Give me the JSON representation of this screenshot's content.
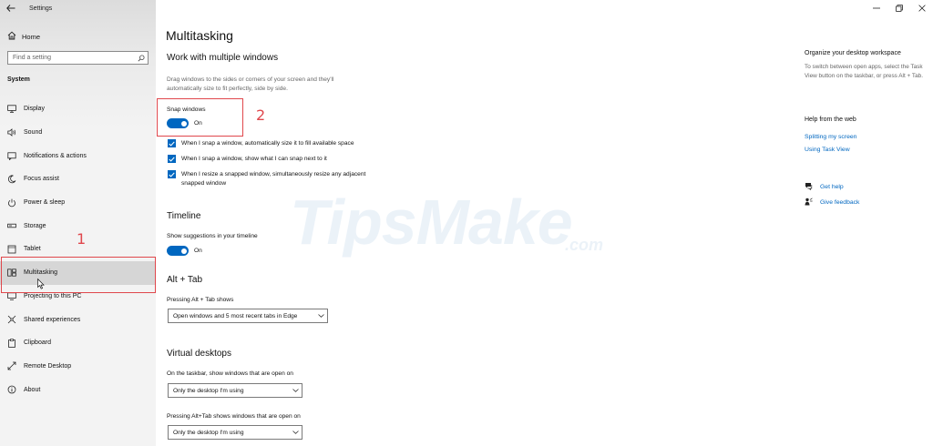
{
  "window": {
    "title": "Settings",
    "back_icon": "back-arrow-icon",
    "minimize_icon": "minimize-icon",
    "restore_icon": "restore-icon",
    "close_icon": "close-icon"
  },
  "sidebar": {
    "home_label": "Home",
    "search_placeholder": "Find a setting",
    "section_title": "System",
    "items": [
      {
        "label": "Display",
        "icon": "display-icon"
      },
      {
        "label": "Sound",
        "icon": "sound-icon"
      },
      {
        "label": "Notifications & actions",
        "icon": "notifications-icon"
      },
      {
        "label": "Focus assist",
        "icon": "focus-assist-icon"
      },
      {
        "label": "Power & sleep",
        "icon": "power-icon"
      },
      {
        "label": "Storage",
        "icon": "storage-icon"
      },
      {
        "label": "Tablet",
        "icon": "tablet-icon"
      },
      {
        "label": "Multitasking",
        "icon": "multitasking-icon",
        "selected": true
      },
      {
        "label": "Projecting to this PC",
        "icon": "projecting-icon"
      },
      {
        "label": "Shared experiences",
        "icon": "shared-experiences-icon"
      },
      {
        "label": "Clipboard",
        "icon": "clipboard-icon"
      },
      {
        "label": "Remote Desktop",
        "icon": "remote-desktop-icon"
      },
      {
        "label": "About",
        "icon": "about-icon"
      }
    ]
  },
  "main": {
    "title": "Multitasking",
    "snap": {
      "heading": "Work with multiple windows",
      "description": "Drag windows to the sides or corners of your screen and they'll automatically size to fit perfectly, side by side.",
      "toggle_label": "Snap windows",
      "toggle_state": "On",
      "options": [
        "When I snap a window, automatically size it to fill available space",
        "When I snap a window, show what I can snap next to it",
        "When I resize a snapped window, simultaneously resize any adjacent snapped window"
      ]
    },
    "timeline": {
      "heading": "Timeline",
      "toggle_label": "Show suggestions in your timeline",
      "toggle_state": "On"
    },
    "alt_tab": {
      "heading": "Alt + Tab",
      "label": "Pressing Alt + Tab shows",
      "value": "Open windows and 5 most recent tabs in Edge"
    },
    "virtual_desktops": {
      "heading": "Virtual desktops",
      "taskbar_label": "On the taskbar, show windows that are open on",
      "taskbar_value": "Only the desktop I'm using",
      "alttab_label": "Pressing Alt+Tab shows windows that are open on",
      "alttab_value": "Only the desktop I'm using"
    }
  },
  "right_panel": {
    "organize_title": "Organize your desktop workspace",
    "organize_text": "To switch between open apps, select the Task View button on the taskbar, or press Alt + Tab.",
    "help_title": "Help from the web",
    "help_links": [
      "Splitting my screen",
      "Using Task View"
    ],
    "get_help": "Get help",
    "give_feedback": "Give feedback"
  },
  "annotations": {
    "marker_1": "1",
    "marker_2": "2"
  },
  "watermark": {
    "text": "TipsMake",
    "domain": ".com"
  },
  "colors": {
    "accent": "#0067c0",
    "highlight": "#e0474c",
    "sidebar_bg": "#f3f3f3"
  }
}
